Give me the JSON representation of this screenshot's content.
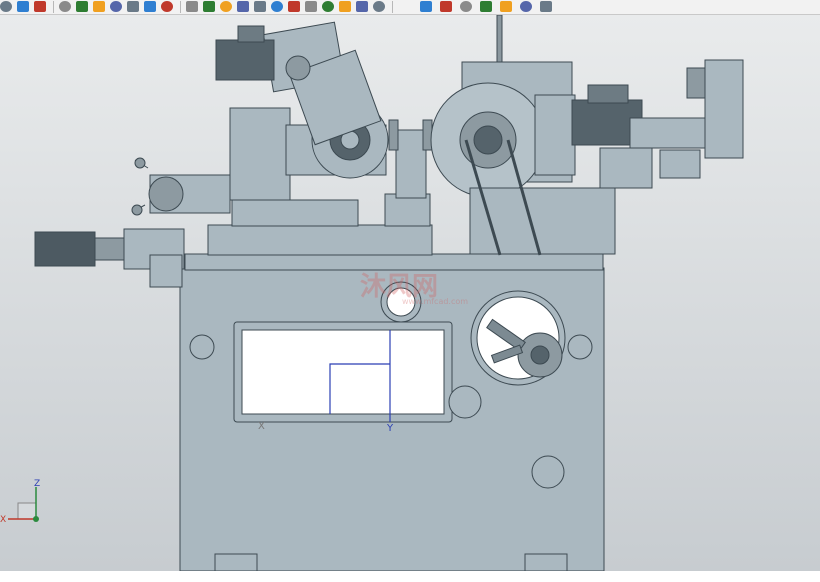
{
  "toolbar": {
    "icons": [
      "select-icon",
      "undo-icon",
      "redo-icon",
      "snap-icon",
      "point-icon",
      "cursor-icon",
      "selection-box-icon",
      "eraser-icon",
      "cube-icon",
      "render-style-icon",
      "line-icon",
      "pen-icon",
      "arc-icon",
      "curve-icon",
      "spline-icon",
      "trim-icon",
      "circle-center-icon",
      "circle-icon",
      "add-point-icon",
      "slash-icon",
      "pin-icon",
      "doc-icon",
      "analysis-icon",
      "layer-icon",
      "rotate-icon",
      "grid-icon",
      "paint-icon",
      "part-icon",
      "view-icon"
    ]
  },
  "viewport": {
    "background_top": "#e9ebec",
    "background_bottom": "#c7ccd0",
    "model_color": "#aab8c0",
    "model_edge": "#3d4a52",
    "dark_part": "#55636b",
    "watermark": "沐风网",
    "watermark_sub": "www.mfcad.com",
    "sketch_x_label": "X",
    "sketch_y_label": "Y",
    "triad": {
      "z_label": "Z",
      "x_label": "X"
    }
  }
}
